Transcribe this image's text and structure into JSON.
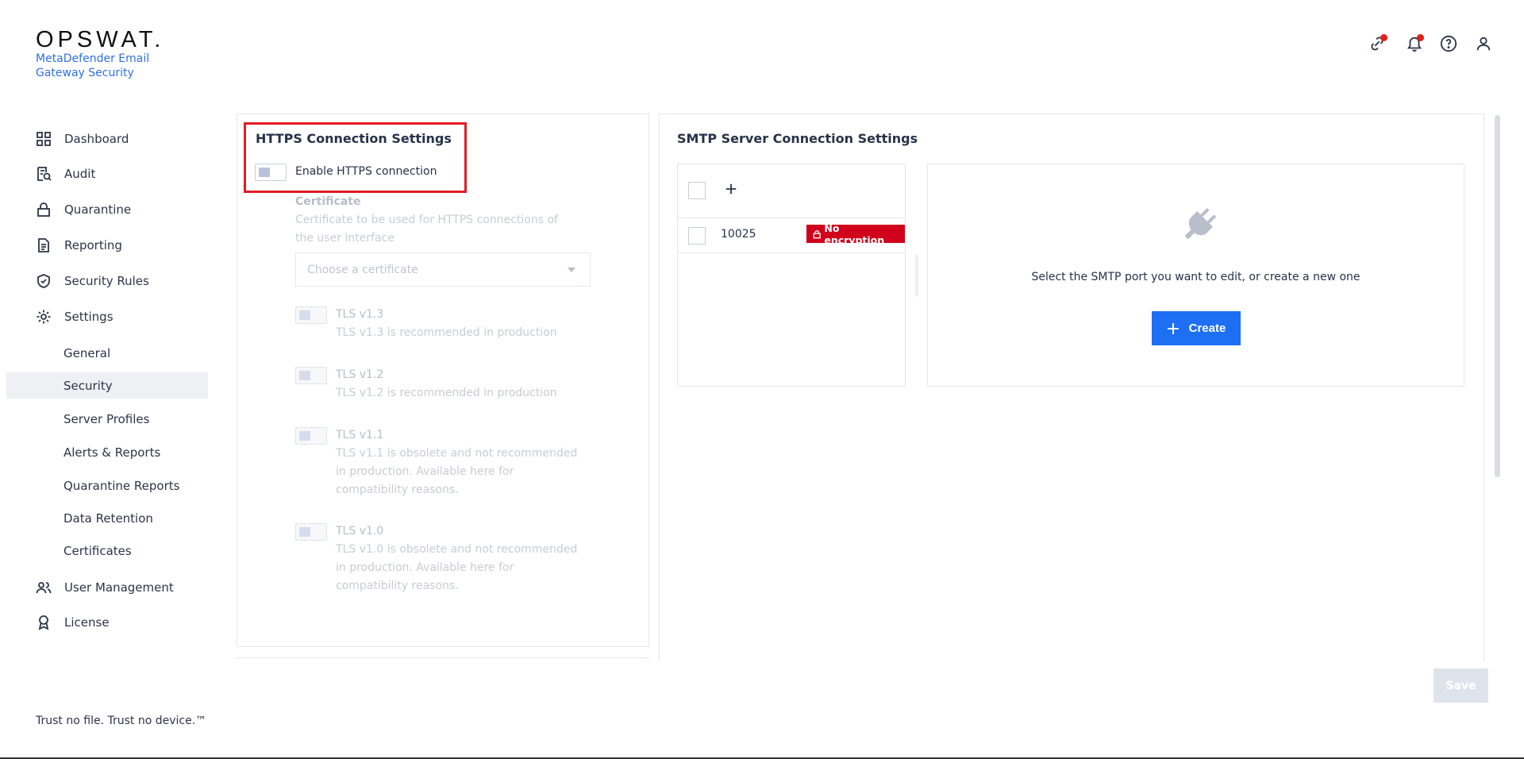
{
  "brand": {
    "logo": "OPSWAT.",
    "product_line1": "MetaDefender Email",
    "product_line2": "Gateway Security",
    "tagline": "Trust no file. Trust no device.™"
  },
  "sidebar": {
    "items": [
      {
        "label": "Dashboard",
        "icon": "dashboard-icon"
      },
      {
        "label": "Audit",
        "icon": "audit-icon"
      },
      {
        "label": "Quarantine",
        "icon": "lock-icon"
      },
      {
        "label": "Reporting",
        "icon": "document-icon"
      },
      {
        "label": "Security Rules",
        "icon": "shield-check-icon"
      },
      {
        "label": "Settings",
        "icon": "gear-icon"
      }
    ],
    "settings_sub": [
      {
        "label": "General"
      },
      {
        "label": "Security",
        "active": true
      },
      {
        "label": "Server Profiles"
      },
      {
        "label": "Alerts & Reports"
      },
      {
        "label": "Quarantine Reports"
      },
      {
        "label": "Data Retention"
      },
      {
        "label": "Certificates"
      }
    ],
    "bottom_items": [
      {
        "label": "User Management",
        "icon": "users-icon"
      },
      {
        "label": "License",
        "icon": "award-icon"
      }
    ]
  },
  "header": {
    "icons": [
      "link-icon",
      "bell-icon",
      "help-icon",
      "user-icon"
    ]
  },
  "https": {
    "title": "HTTPS Connection Settings",
    "enable_label": "Enable HTTPS connection",
    "enabled": false,
    "certificate_label": "Certificate",
    "certificate_desc": "Certificate to be used for HTTPS connections of the user interface",
    "certificate_placeholder": "Choose a certificate",
    "tls": [
      {
        "label": "TLS v1.3",
        "desc": "TLS v1.3 is recommended in production"
      },
      {
        "label": "TLS v1.2",
        "desc": "TLS v1.2 is recommended in production"
      },
      {
        "label": "TLS v1.1",
        "desc": "TLS v1.1 is obsolete and not recommended in production. Available here for compatibility reasons."
      },
      {
        "label": "TLS v1.0",
        "desc": "TLS v1.0 is obsolete and not recommended in production. Available here for compatibility reasons."
      }
    ]
  },
  "smtp": {
    "title": "SMTP Server Connection Settings",
    "ports": [
      {
        "port": "10025",
        "badge": "No encryption"
      }
    ],
    "empty_message": "Select the SMTP port you want to edit, or create a new one",
    "create_label": "Create"
  },
  "actions": {
    "save_label": "Save"
  },
  "colors": {
    "accent": "#1d6ff3",
    "danger": "#d0021b",
    "highlight": "#e31b23"
  }
}
